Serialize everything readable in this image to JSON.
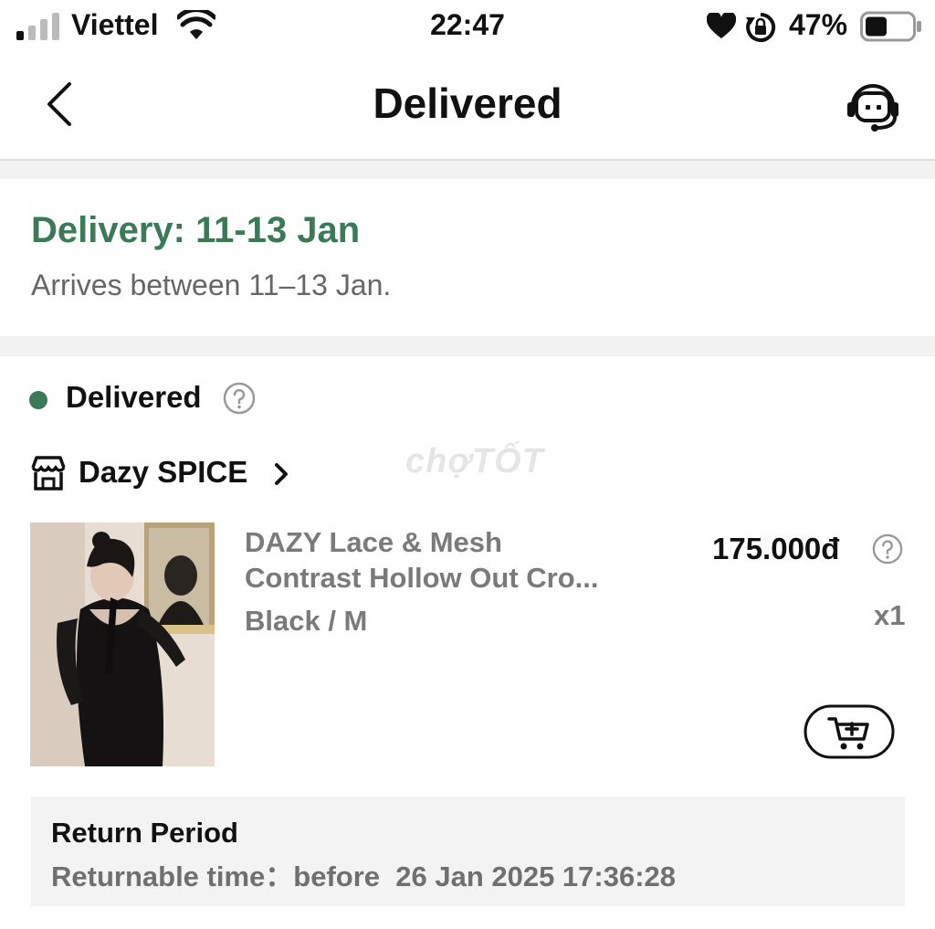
{
  "status_bar": {
    "carrier": "Viettel",
    "time": "22:47",
    "battery_percent": "47%",
    "battery_level": 0.47,
    "icons": [
      "signal-icon",
      "wifi-icon",
      "heart-icon",
      "rotation-lock-icon",
      "battery-icon"
    ]
  },
  "nav": {
    "title": "Delivered",
    "back_icon": "chevron-left-icon",
    "support_icon": "customer-service-icon"
  },
  "delivery": {
    "title": "Delivery: 11-13 Jan",
    "subtitle": "Arrives between 11–13 Jan."
  },
  "order_status": {
    "label": "Delivered",
    "help_icon": "question-icon"
  },
  "shop": {
    "name": "Dazy SPICE",
    "icon": "store-icon"
  },
  "watermark": "chợTỐT",
  "product": {
    "name": "DAZY Lace & Mesh Contrast Hollow Out Cro...",
    "name_line1": "DAZY Lace & Mesh",
    "name_line2": "Contrast Hollow Out Cro...",
    "variant": "Black / M",
    "price": "175.000đ",
    "quantity": "x1",
    "add_to_cart_icon": "cart-plus-icon"
  },
  "return_period": {
    "title": "Return Period",
    "text": "Returnable time：before  26 Jan 2025 17:36:28"
  },
  "colors": {
    "accent_green": "#3b7a57",
    "muted_text": "#7a7a7a",
    "section_gap": "#f2f2f2"
  }
}
